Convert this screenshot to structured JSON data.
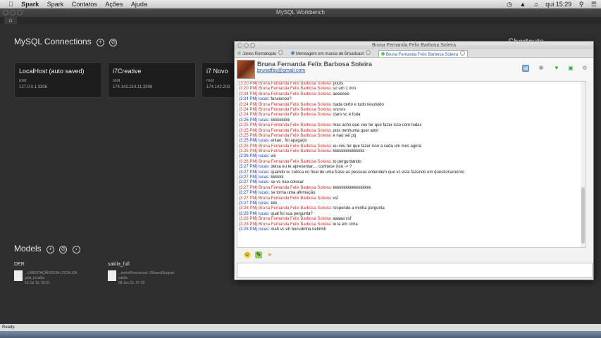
{
  "menubar": {
    "items": [
      "Spark",
      "Spark",
      "Contatos",
      "Ações",
      "Ajuda"
    ],
    "clock": "qui 15:29"
  },
  "workbench": {
    "title": "MySQL Workbench",
    "sections": {
      "connections": "MySQL Connections",
      "models": "Models",
      "shortcuts": "Shortcuts"
    },
    "connections": [
      {
        "name": "LocalHost (auto saved)",
        "user": "root",
        "host": "127.0.0.1:3306"
      },
      {
        "name": "i7Creative",
        "user": "root",
        "host": "174.142.214.11:3306"
      },
      {
        "name": "i7 Novo",
        "user": "root",
        "host": "174.142.203"
      }
    ],
    "models": [
      {
        "name": "DER",
        "path": "...UMENTAÇÃO/GUIA LOCALIZA",
        "schema": "guia_locaiba",
        "date": "15 Jul 15, 09:31"
      },
      {
        "name": "sakila_full",
        "path": "...tents/Resources/../SharedSupport",
        "schema": "sakila",
        "date": "08 Jun 15, 07:39"
      }
    ],
    "status": "Ready."
  },
  "chat": {
    "title": "Bruna Fernanda Felix Barbosa Soleira",
    "tabs": [
      "Jones Romanquio",
      "Mensagem em massa de Broadcast",
      "Bruna Fernanda Felix Barbosa Soleira"
    ],
    "contact_name": "Bruna Fernanda Felix Barbosa Soleira",
    "contact_email": "brunaffbs@gmail.com",
    "messages": [
      {
        "time": "(3:20 PM)",
        "who": "Bruna Fernanda Felix Barbosa Soleira:",
        "me": false,
        "text": "pouts"
      },
      {
        "time": "(3:20 PM)",
        "who": "Bruna Fernanda Felix Barbosa Soleira:",
        "me": false,
        "text": "so um 1 min"
      },
      {
        "time": "(3:24 PM)",
        "who": "Bruna Fernanda Felix Barbosa Soleira:",
        "me": false,
        "text": "aeeeeee"
      },
      {
        "time": "(3:24 PM)",
        "who": "lucas:",
        "me": true,
        "text": "funcionou?"
      },
      {
        "time": "(3:24 PM)",
        "who": "Bruna Fernanda Felix Barbosa Soleira:",
        "me": false,
        "text": "nada certo e tudo resolvido"
      },
      {
        "time": "(3:24 PM)",
        "who": "Bruna Fernanda Felix Barbosa Soleira:",
        "me": false,
        "text": "srsrsrs"
      },
      {
        "time": "(3:24 PM)",
        "who": "Bruna Fernanda Felix Barbosa Soleira:",
        "me": false,
        "text": "claro vc é foda"
      },
      {
        "time": "(3:25 PM)",
        "who": "lucas:",
        "me": true,
        "text": "kkkkkkkkk"
      },
      {
        "time": "(3:25 PM)",
        "who": "Bruna Fernanda Felix Barbosa Soleira:",
        "me": false,
        "text": "mas acho que vou ter que fazer isso com todas"
      },
      {
        "time": "(3:25 PM)",
        "who": "Bruna Fernanda Felix Barbosa Soleira:",
        "me": false,
        "text": "pois nenhuma quer abrir"
      },
      {
        "time": "(3:25 PM)",
        "who": "Bruna Fernanda Felix Barbosa Soleira:",
        "me": false,
        "text": "e nao sei pq"
      },
      {
        "time": "(3:25 PM)",
        "who": "lucas:",
        "me": true,
        "text": "entao.. foi apagado"
      },
      {
        "time": "(3:25 PM)",
        "who": "Bruna Fernanda Felix Barbosa Soleira:",
        "me": false,
        "text": "eu vou ter que fazer isso a cada um mes agora"
      },
      {
        "time": "(3:25 PM)",
        "who": "Bruna Fernanda Felix Barbosa Soleira:",
        "me": false,
        "text": "kkkkkkkkkkkkkkk"
      },
      {
        "time": "(3:26 PM)",
        "who": "lucas:",
        "me": true,
        "text": "vix"
      },
      {
        "time": "(3:26 PM)",
        "who": "Bruna Fernanda Felix Barbosa Soleira:",
        "me": false,
        "text": "to perguntando"
      },
      {
        "time": "(3:27 PM)",
        "who": "lucas:",
        "me": true,
        "text": "deixa eu te apresentar.... conhece isso -> ?"
      },
      {
        "time": "(3:27 PM)",
        "who": "lucas:",
        "me": true,
        "text": "quando vc coloca no final de uma frase as pessoas entendem que vc esta fazendo um questionamento"
      },
      {
        "time": "(3:27 PM)",
        "who": "lucas:",
        "me": true,
        "text": "kkkkkk"
      },
      {
        "time": "(3:27 PM)",
        "who": "lucas:",
        "me": true,
        "text": "se vc nao colocar"
      },
      {
        "time": "(3:27 PM)",
        "who": "Bruna Fernanda Felix Barbosa Soleira:",
        "me": false,
        "text": "kkkkkkkkkkkkkkkkkk"
      },
      {
        "time": "(3:27 PM)",
        "who": "lucas:",
        "me": true,
        "text": "se torna uma afirmação"
      },
      {
        "time": "(3:27 PM)",
        "who": "Bruna Fernanda Felix Barbosa Soleira:",
        "me": false,
        "text": "vsf"
      },
      {
        "time": "(3:27 PM)",
        "who": "lucas:",
        "me": true,
        "text": "kkk"
      },
      {
        "time": "(3:28 PM)",
        "who": "Bruna Fernanda Felix Barbosa Soleira:",
        "me": false,
        "text": "responde a minha pergunta"
      },
      {
        "time": "(3:28 PM)",
        "who": "lucas:",
        "me": true,
        "text": "qual foi sua pergunta?"
      },
      {
        "time": "(3:28 PM)",
        "who": "Bruna Fernanda Felix Barbosa Soleira:",
        "me": false,
        "text": "aaaaa vsf"
      },
      {
        "time": "(3:28 PM)",
        "who": "Bruna Fernanda Felix Barbosa Soleira:",
        "me": false,
        "text": "le la em cima"
      },
      {
        "time": "(3:28 PM)",
        "who": "lucas:",
        "me": true,
        "text": "mah vc eh bocudinha nehhhh"
      }
    ],
    "colors": {
      "me": "#1c39c9",
      "them": "#d0302d",
      "link": "#2a5db0"
    }
  }
}
